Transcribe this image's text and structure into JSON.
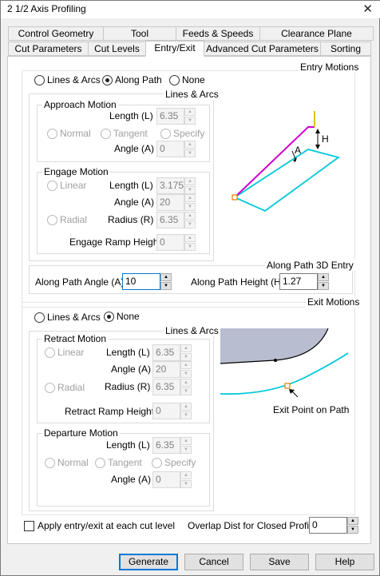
{
  "window": {
    "title": "2 1/2 Axis Profiling",
    "close_glyph": "✕"
  },
  "tabs": {
    "row1": [
      "Control Geometry",
      "Tool",
      "Feeds & Speeds",
      "Clearance Plane"
    ],
    "row2": [
      "Cut Parameters",
      "Cut Levels",
      "Entry/Exit",
      "Advanced Cut Parameters",
      "Sorting"
    ],
    "active": "Entry/Exit"
  },
  "entry": {
    "group_label": "Entry Motions",
    "mode_options": [
      "Lines & Arcs",
      "Along Path",
      "None"
    ],
    "selected_mode": "Along Path",
    "lines_arcs_label": "Lines & Arcs",
    "approach": {
      "label": "Approach Motion",
      "length_label": "Length (L)",
      "length": "6.35",
      "options": [
        "Normal",
        "Tangent",
        "Specify"
      ],
      "angle_label": "Angle (A)",
      "angle": "0"
    },
    "engage": {
      "label": "Engage Motion",
      "linear_label": "Linear",
      "length_label": "Length (L)",
      "length": "3.175",
      "angle_label": "Angle (A)",
      "angle": "20",
      "radial_label": "Radial",
      "radius_label": "Radius (R)",
      "radius": "6.35",
      "ramp_label": "Engage Ramp Height",
      "ramp": "0"
    },
    "diagram": {
      "h_label": "H",
      "a_label": "A"
    }
  },
  "along_path": {
    "group_label": "Along Path 3D Entry",
    "angle_label": "Along Path Angle (A)",
    "angle": "10",
    "height_label": "Along Path Height (H)",
    "height": "1.27"
  },
  "exit": {
    "group_label": "Exit Motions",
    "mode_options": [
      "Lines & Arcs",
      "None"
    ],
    "selected_mode": "None",
    "lines_arcs_label": "Lines & Arcs",
    "retract": {
      "label": "Retract Motion",
      "linear_label": "Linear",
      "length_label": "Length (L)",
      "length": "6.35",
      "angle_label": "Angle (A)",
      "angle": "20",
      "radial_label": "Radial",
      "radius_label": "Radius (R)",
      "radius": "6.35",
      "ramp_label": "Retract Ramp Height",
      "ramp": "0"
    },
    "departure": {
      "label": "Departure Motion",
      "length_label": "Length (L)",
      "length": "6.35",
      "options": [
        "Normal",
        "Tangent",
        "Specify"
      ],
      "angle_label": "Angle (A)",
      "angle": "0"
    },
    "diagram": {
      "caption": "Exit Point on Path"
    }
  },
  "footer": {
    "apply_label": "Apply entry/exit at each cut level",
    "apply_checked": false,
    "overlap_label": "Overlap Dist for Closed Profiles",
    "overlap": "0"
  },
  "buttons": {
    "generate": "Generate",
    "cancel": "Cancel",
    "save": "Save",
    "help": "Help"
  },
  "colors": {
    "path_magenta": "#d000d0",
    "part_cyan": "#00c8d8",
    "tool_yellow": "#e0c000",
    "accent": "#0078d7",
    "stock_gray": "#b8bdd0"
  }
}
